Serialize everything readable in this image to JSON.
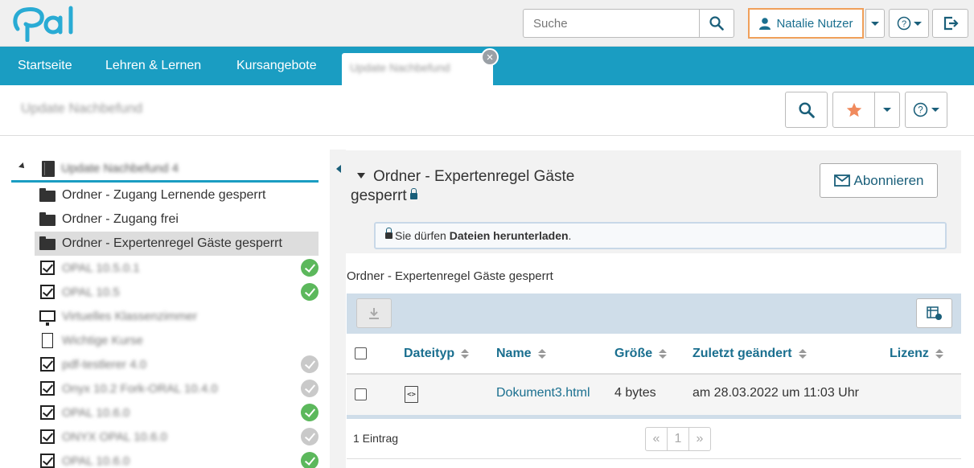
{
  "header": {
    "logo_text": "Opal",
    "search_placeholder": "Suche",
    "user_name": "Natalie Nutzer"
  },
  "nav": {
    "tabs": [
      "Startseite",
      "Lehren & Lernen",
      "Kursangebote"
    ],
    "active_tab_label": "Update Nachbefund"
  },
  "course": {
    "title": "Update Nachbefund"
  },
  "tree": {
    "root_label": "Update Nachbefund 4",
    "items": [
      {
        "type": "folder",
        "label": "Ordner - Zugang Lernende gesperrt"
      },
      {
        "type": "folder",
        "label": "Ordner - Zugang frei"
      },
      {
        "type": "folder",
        "label": "Ordner - Expertenregel Gäste gesperrt",
        "selected": true
      },
      {
        "type": "check",
        "label": "OPAL 10.5.0.1",
        "status": "green"
      },
      {
        "type": "check",
        "label": "OPAL 10.5",
        "status": "green"
      },
      {
        "type": "monitor",
        "label": "Virtuelles Klassenzimmer"
      },
      {
        "type": "page",
        "label": "Wichtige Kurse"
      },
      {
        "type": "check",
        "label": "pdf-testlerer 4.0",
        "status": "grey"
      },
      {
        "type": "check",
        "label": "Onyx 10.2 Fork-ORAL 10.4.0",
        "status": "grey"
      },
      {
        "type": "check",
        "label": "OPAL 10.6.0",
        "status": "green"
      },
      {
        "type": "check",
        "label": "ONYX OPAL 10.6.0",
        "status": "grey"
      },
      {
        "type": "check",
        "label": "OPAL 10.6.0",
        "status": "green"
      }
    ]
  },
  "folder": {
    "title": "Ordner - Expertenregel Gäste gesperrt",
    "subscribe_label": "Abonnieren",
    "info_prefix": "Sie dürfen ",
    "info_bold": "Dateien herunterladen",
    "info_suffix": ".",
    "listing_title": "Ordner - Expertenregel Gäste gesperrt"
  },
  "table": {
    "columns": [
      "Dateityp",
      "Name",
      "Größe",
      "Zuletzt geändert",
      "Lizenz"
    ],
    "rows": [
      {
        "name": "Dokument3.html",
        "size": "4 bytes",
        "modified": "am 28.03.2022 um 11:03 Uhr",
        "license": ""
      }
    ],
    "entries_label": "1 Eintrag",
    "pager": {
      "prev": "«",
      "page": "1",
      "next": "»"
    }
  },
  "colors": {
    "accent": "#1a9dc2",
    "link": "#1a6f8f",
    "favorite": "#f08a5d",
    "success": "#5cb85c"
  }
}
